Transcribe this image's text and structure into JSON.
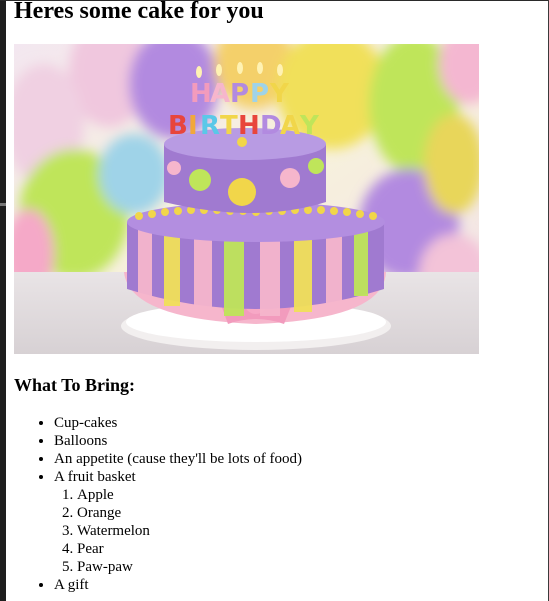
{
  "heading": "Heres some cake for you",
  "image": {
    "alt": "Happy Birthday cake",
    "candle_text": "HAPPY BIRTHDAY"
  },
  "subheading": "What To Bring:",
  "bring_list": [
    "Cup-cakes",
    "Balloons",
    "An appetite (cause they'll be lots of food)",
    "A fruit basket",
    "A gift"
  ],
  "fruits": [
    "Apple",
    "Orange",
    "Watermelon",
    "Pear",
    "Paw-paw"
  ],
  "colors": {
    "cake_purple": "#a07ad0",
    "frosting_pink": "#f6b6cc",
    "balloon_yellow": "#f1e05a",
    "balloon_green": "#bfe55a",
    "balloon_purple": "#b28ae0"
  }
}
